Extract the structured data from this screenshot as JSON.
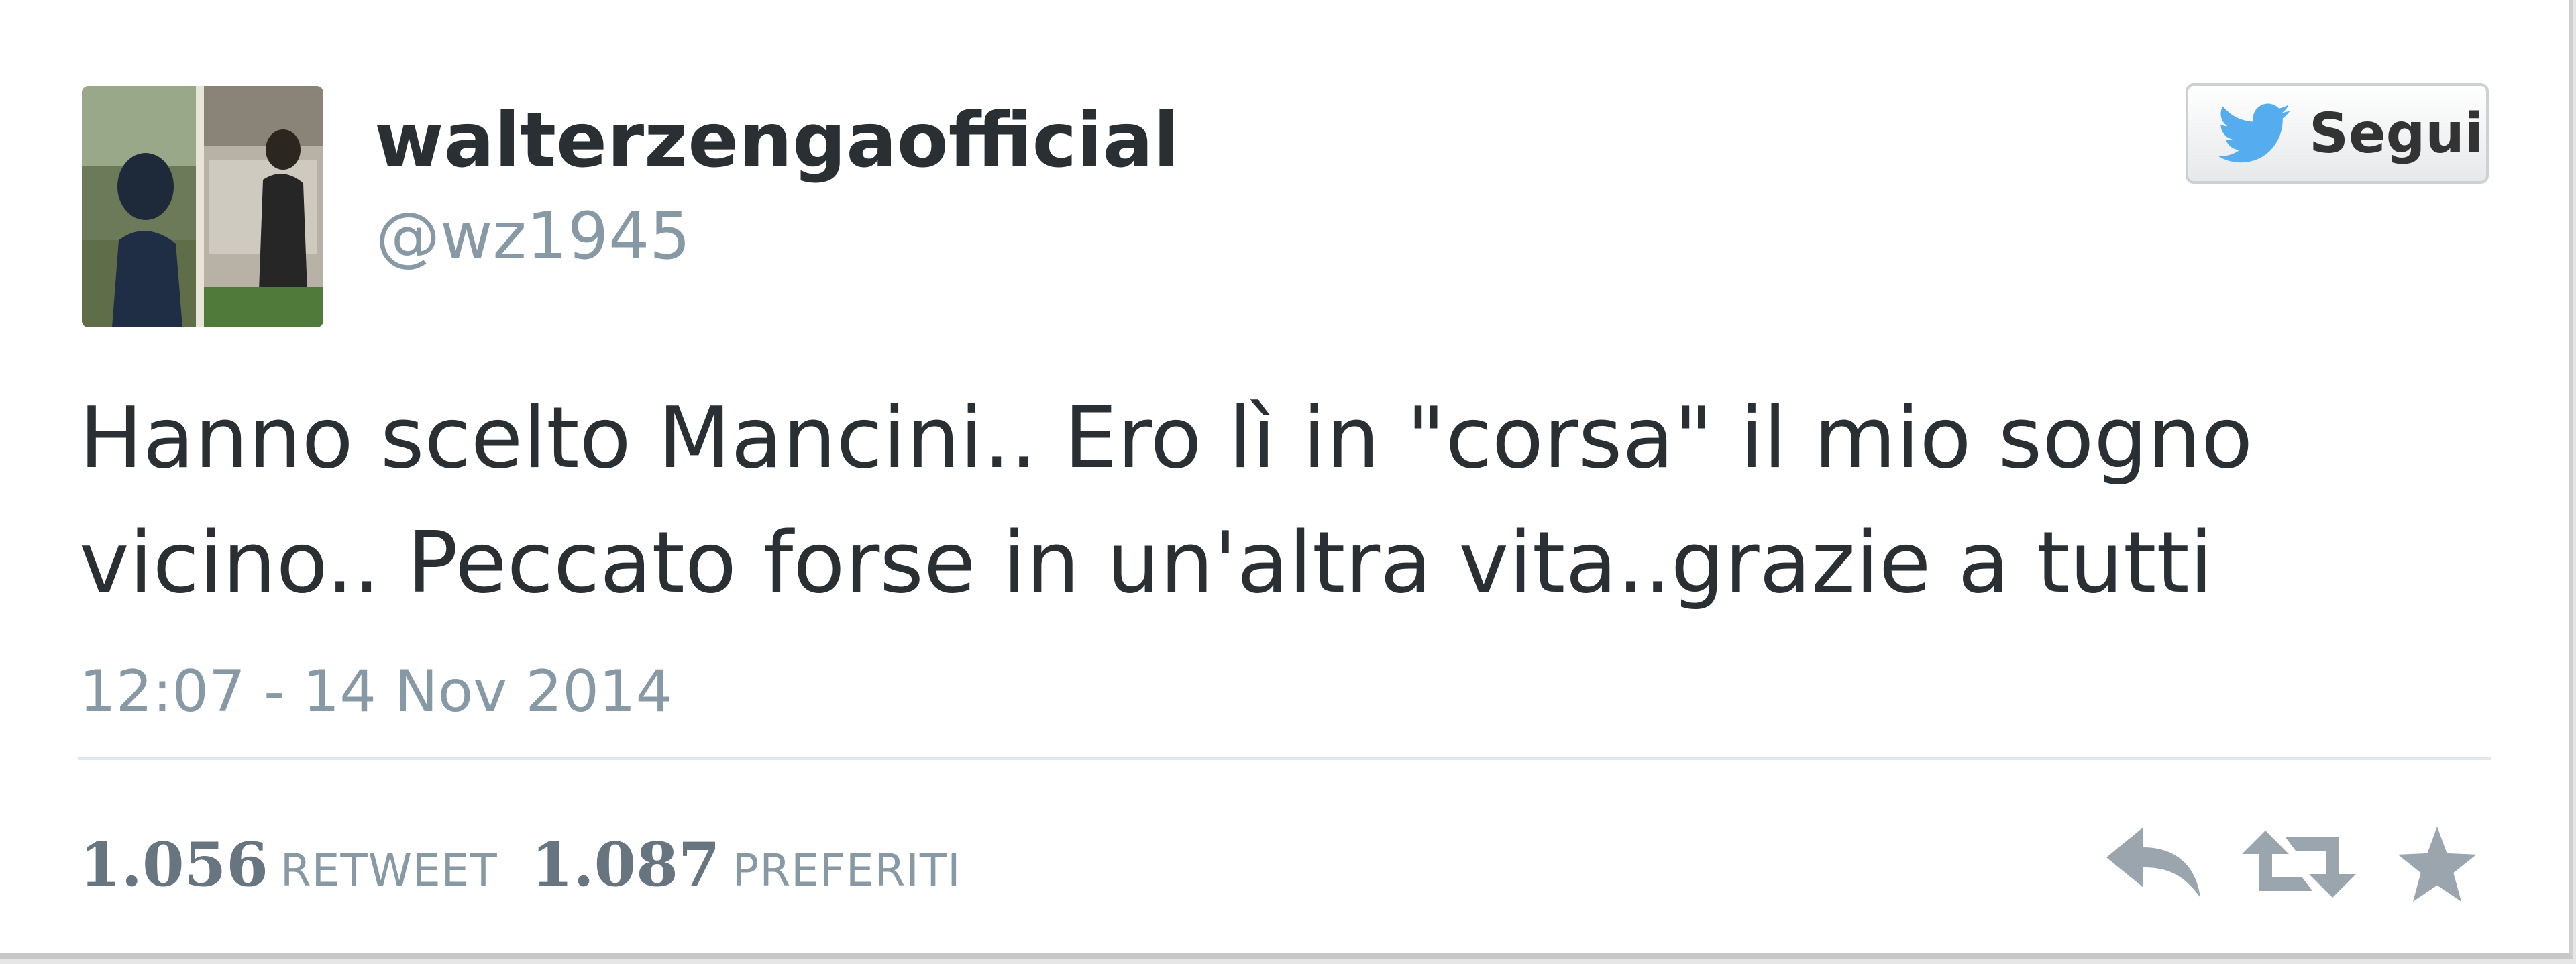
{
  "tweet": {
    "display_name": "walterzengaofficial",
    "screen_name": "@wz1945",
    "text": "Hanno scelto Mancini.. Ero lì in \"corsa\" il mio sogno vicino.. Peccato forse in un'altra vita..grazie a tutti",
    "timestamp": "12:07 - 14 Nov 2014",
    "follow_label": "Segui",
    "retweet_count": "1.056",
    "retweet_label": "RETWEET",
    "favorite_count": "1.087",
    "favorite_label": "PREFERITI"
  },
  "icons": {
    "follow": "twitter-bird-icon",
    "reply": "reply-icon",
    "retweet": "retweet-icon",
    "favorite": "star-icon"
  },
  "colors": {
    "twitter_blue": "#55acee",
    "text": "#292f33",
    "muted": "#8899a6",
    "action_gray": "#9aa5ae"
  }
}
